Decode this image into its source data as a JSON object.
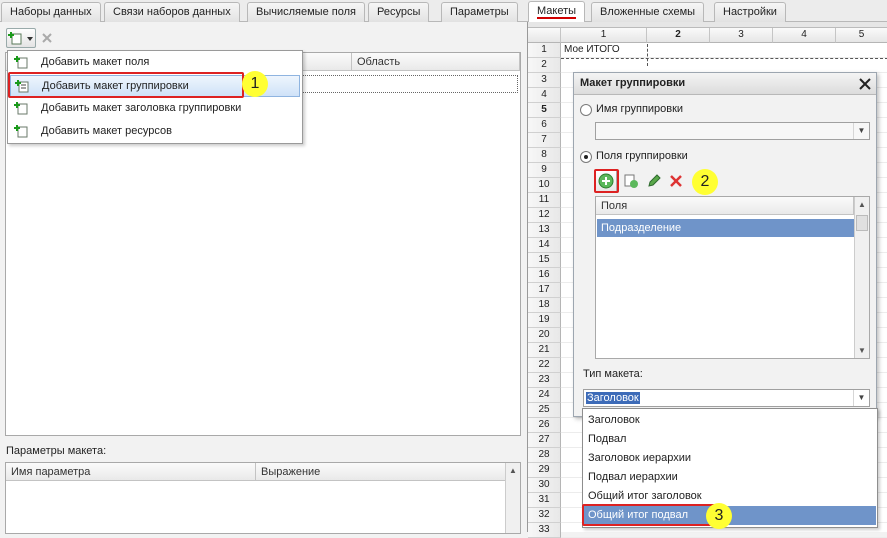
{
  "tabs": [
    "Наборы данных",
    "Связи наборов данных",
    "Вычисляемые поля",
    "Ресурсы",
    "Параметры",
    "Макеты",
    "Вложенные схемы",
    "Настройки"
  ],
  "active_tab": "Макеты",
  "layouts_table": {
    "col1": "",
    "col2": "Область"
  },
  "add_menu": {
    "items": [
      "Добавить макет поля",
      "Добавить макет группировки",
      "Добавить макет заголовка группировки",
      "Добавить макет ресурсов"
    ],
    "selected": 1
  },
  "params_section": {
    "label": "Параметры макета:",
    "col_name": "Имя параметра",
    "col_expr": "Выражение"
  },
  "sheet": {
    "col_headers": [
      "1",
      "2",
      "3",
      "4",
      "5"
    ],
    "rows": [
      "1",
      "2",
      "3",
      "4",
      "5",
      "6",
      "7",
      "8",
      "9",
      "10",
      "11",
      "12",
      "13",
      "14",
      "15",
      "16",
      "17",
      "18",
      "19",
      "20",
      "21",
      "22",
      "23",
      "24",
      "25",
      "26",
      "27",
      "28",
      "29",
      "30",
      "31",
      "32",
      "33"
    ],
    "cell_r1c1": "Мое ИТОГО"
  },
  "dialog": {
    "title": "Макет группировки",
    "radio_name_label": "Имя группировки",
    "radio_fields_label": "Поля группировки",
    "fields_col_header": "Поля",
    "fields": [
      "Подразделение"
    ],
    "layout_type_label": "Тип макета:",
    "layout_type_value": "Заголовок"
  },
  "layout_type_options": [
    "Заголовок",
    "Подвал",
    "Заголовок иерархии",
    "Подвал иерархии",
    "Общий итог заголовок",
    "Общий итог подвал"
  ],
  "layout_type_highlight": 5,
  "badges": [
    "1",
    "2",
    "3"
  ],
  "colors": {
    "accent_red": "#d22222",
    "badge_yellow": "#ffff33",
    "selection_blue": "#6f94c9"
  }
}
